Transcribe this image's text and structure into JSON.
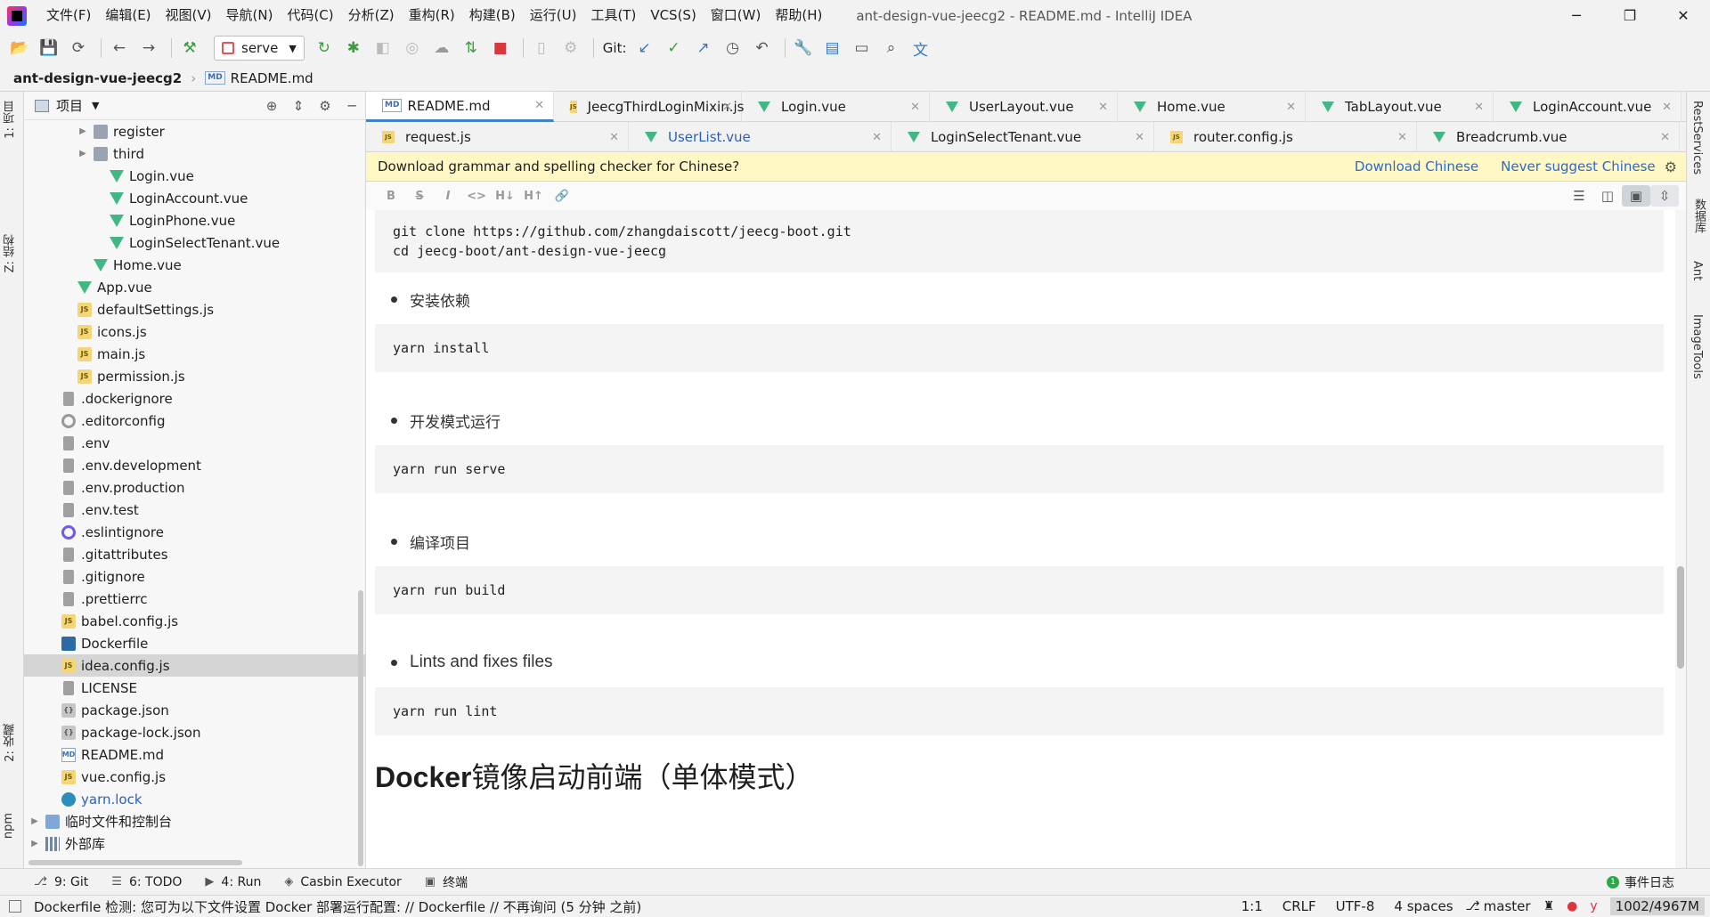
{
  "window": {
    "title": "ant-design-vue-jeecg2 - README.md - IntelliJ IDEA",
    "minimize": "─",
    "restore": "❐",
    "close": "✕"
  },
  "menu": [
    "文件(F)",
    "编辑(E)",
    "视图(V)",
    "导航(N)",
    "代码(C)",
    "分析(Z)",
    "重构(R)",
    "构建(B)",
    "运行(U)",
    "工具(T)",
    "VCS(S)",
    "窗口(W)",
    "帮助(H)"
  ],
  "toolbar": {
    "run_config": "serve",
    "git_label": "Git:"
  },
  "breadcrumb": {
    "project": "ant-design-vue-jeecg2",
    "file": "README.md",
    "file_badge": "MD"
  },
  "left_strip": {
    "project_tab": "1: 项目",
    "structure_tab": "Z: 结构",
    "favorites_tab": "2: 收藏",
    "npm_tab": "npm"
  },
  "project_panel": {
    "title": "项目",
    "tree": [
      {
        "label": "register",
        "icon": "folder",
        "indent": 1,
        "arrow": "▶"
      },
      {
        "label": "third",
        "icon": "folder",
        "indent": 1,
        "arrow": "▶"
      },
      {
        "label": "Login.vue",
        "icon": "vue",
        "indent": 2
      },
      {
        "label": "LoginAccount.vue",
        "icon": "vue",
        "indent": 2
      },
      {
        "label": "LoginPhone.vue",
        "icon": "vue",
        "indent": 2
      },
      {
        "label": "LoginSelectTenant.vue",
        "icon": "vue",
        "indent": 2
      },
      {
        "label": "Home.vue",
        "icon": "vue",
        "indent": 1
      },
      {
        "label": "App.vue",
        "icon": "vue",
        "indent": 0
      },
      {
        "label": "defaultSettings.js",
        "icon": "js",
        "indent": 0
      },
      {
        "label": "icons.js",
        "icon": "js",
        "indent": 0
      },
      {
        "label": "main.js",
        "icon": "js",
        "indent": 0
      },
      {
        "label": "permission.js",
        "icon": "js",
        "indent": 0
      },
      {
        "label": ".dockerignore",
        "icon": "file",
        "indent": -1
      },
      {
        "label": ".editorconfig",
        "icon": "gear",
        "indent": -1
      },
      {
        "label": ".env",
        "icon": "file",
        "indent": -1
      },
      {
        "label": ".env.development",
        "icon": "file",
        "indent": -1
      },
      {
        "label": ".env.production",
        "icon": "file",
        "indent": -1
      },
      {
        "label": ".env.test",
        "icon": "file",
        "indent": -1
      },
      {
        "label": ".eslintignore",
        "icon": "eslint",
        "indent": -1
      },
      {
        "label": ".gitattributes",
        "icon": "file",
        "indent": -1
      },
      {
        "label": ".gitignore",
        "icon": "file",
        "indent": -1
      },
      {
        "label": ".prettierrc",
        "icon": "file",
        "indent": -1
      },
      {
        "label": "babel.config.js",
        "icon": "js",
        "indent": -1
      },
      {
        "label": "Dockerfile",
        "icon": "docker",
        "indent": -1
      },
      {
        "label": "idea.config.js",
        "icon": "js",
        "indent": -1,
        "selected": true
      },
      {
        "label": "LICENSE",
        "icon": "file",
        "indent": -1
      },
      {
        "label": "package.json",
        "icon": "json",
        "indent": -1
      },
      {
        "label": "package-lock.json",
        "icon": "json",
        "indent": -1
      },
      {
        "label": "README.md",
        "icon": "md",
        "indent": -1
      },
      {
        "label": "vue.config.js",
        "icon": "js",
        "indent": -1
      },
      {
        "label": "yarn.lock",
        "icon": "yarn",
        "indent": -1,
        "blue": true
      },
      {
        "label": "临时文件和控制台",
        "icon": "scratch",
        "indent": -2,
        "arrow": "▶"
      },
      {
        "label": "外部库",
        "icon": "libs",
        "indent": -2,
        "arrow": "▶"
      }
    ]
  },
  "tabs_row1": [
    {
      "label": "README.md",
      "icon": "md",
      "active": true
    },
    {
      "label": "JeecgThirdLoginMixin.js",
      "icon": "js"
    },
    {
      "label": "Login.vue",
      "icon": "vue"
    },
    {
      "label": "UserLayout.vue",
      "icon": "vue"
    },
    {
      "label": "Home.vue",
      "icon": "vue"
    },
    {
      "label": "TabLayout.vue",
      "icon": "vue"
    },
    {
      "label": "LoginAccount.vue",
      "icon": "vue"
    }
  ],
  "tabs_row2": [
    {
      "label": "request.js",
      "icon": "js"
    },
    {
      "label": "UserList.vue",
      "icon": "vue",
      "modified": true
    },
    {
      "label": "LoginSelectTenant.vue",
      "icon": "vue"
    },
    {
      "label": "router.config.js",
      "icon": "js"
    },
    {
      "label": "Breadcrumb.vue",
      "icon": "vue"
    }
  ],
  "notification": {
    "message": "Download grammar and spelling checker for Chinese?",
    "download": "Download Chinese",
    "never": "Never suggest Chinese"
  },
  "md_toolbar": [
    "B",
    "S",
    "I",
    "<>",
    "H↓",
    "H↑",
    "🔗"
  ],
  "preview": {
    "code1_line1": "git clone https://github.com/zhangdaiscott/jeecg-boot.git",
    "code1_line2": "cd  jeecg-boot/ant-design-vue-jeecg",
    "bullet1": "安装依赖",
    "code2": "yarn install",
    "bullet2": "开发模式运行",
    "code3": "yarn run serve",
    "bullet3": "编译项目",
    "code4": "yarn run build",
    "bullet4": "Lints and fixes files",
    "code5": "yarn run lint",
    "heading_en": "Docker",
    "heading_cn": "镜像启动前端（单体模式）"
  },
  "right_strip": {
    "rest": "RestServices",
    "db": "数据库",
    "ant": "Ant",
    "image": "ImageTools"
  },
  "toolwindows": [
    {
      "label": "9: Git",
      "icon": "⎇"
    },
    {
      "label": "6: TODO",
      "icon": "☰"
    },
    {
      "label": "4: Run",
      "icon": "▶"
    },
    {
      "label": "Casbin Executor",
      "icon": "◈"
    },
    {
      "label": "终端",
      "icon": "▣"
    }
  ],
  "event_log": "事件日志",
  "event_count": "1",
  "status": {
    "message": "Dockerfile 检测: 您可为以下文件设置 Docker 部署运行配置: // Dockerfile // 不再询问 (5 分钟 之前)",
    "position": "1:1",
    "line_sep": "CRLF",
    "encoding": "UTF-8",
    "indent": "4 spaces",
    "branch": "master",
    "memory": "1002/4967M"
  }
}
